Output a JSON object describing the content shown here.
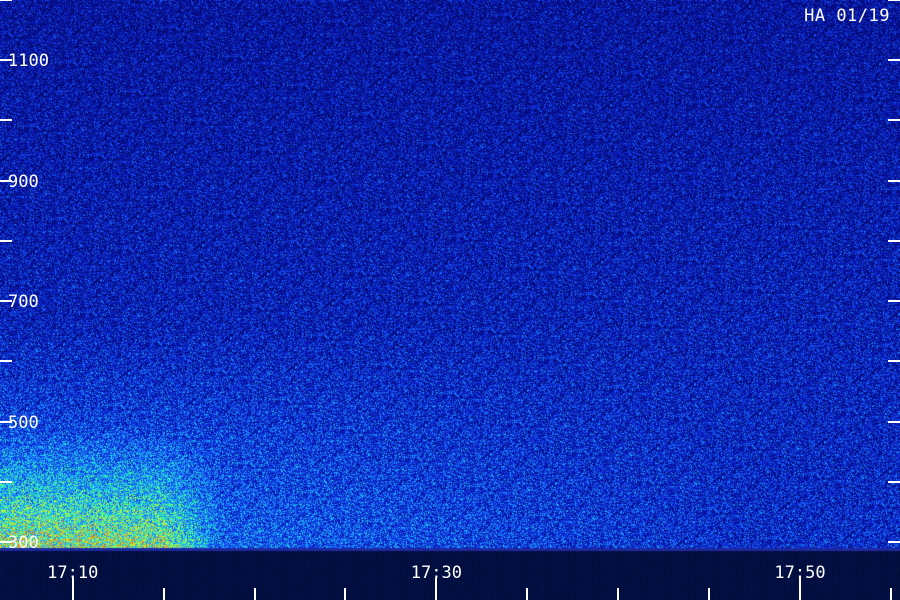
{
  "chart_data": {
    "type": "heatmap",
    "title": "HA 01/19",
    "xlabel": "",
    "ylabel": "",
    "x_tick_labels": [
      "17:10",
      "17:30",
      "17:50"
    ],
    "x_tick_values_min": [
      1030,
      1050,
      1070
    ],
    "xlim_min": [
      1026,
      1075.5
    ],
    "y_tick_labels": [
      "1100",
      "900",
      "700",
      "500",
      "300"
    ],
    "y_tick_values": [
      1100,
      900,
      700,
      500,
      300
    ],
    "y_minor_tick_values": [
      1200,
      1000,
      800,
      600,
      400
    ],
    "ylim": [
      290,
      1200
    ],
    "grid": false,
    "colormap": [
      "#05086a",
      "#0a1cc8",
      "#1a66ff",
      "#20d0ff",
      "#30ff90",
      "#e0ff20",
      "#ff6a10"
    ],
    "background_color": "#05086a",
    "intensity_regions": [
      {
        "time_min": [
          1026,
          1035
        ],
        "freq": [
          300,
          400
        ],
        "level": "high"
      },
      {
        "time_min": [
          1026,
          1045
        ],
        "freq": [
          300,
          600
        ],
        "level": "elevated"
      },
      {
        "time_min": [
          1026,
          1075.5
        ],
        "freq": [
          300,
          1200
        ],
        "level": "background"
      }
    ]
  }
}
